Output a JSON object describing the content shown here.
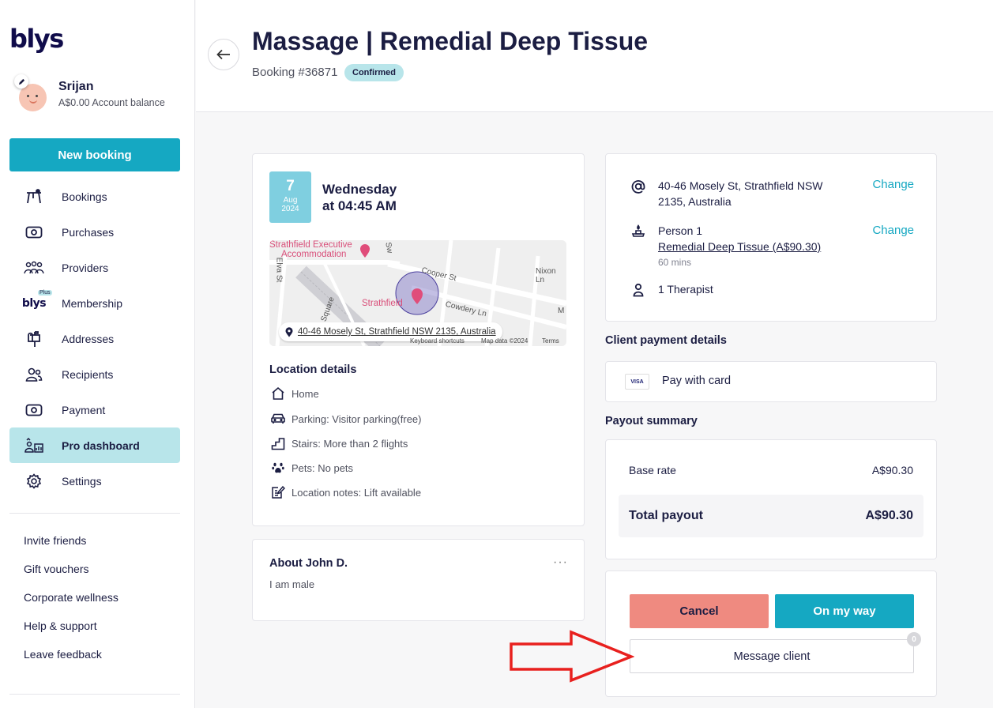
{
  "brand": {
    "logo_text": "blys",
    "accent": "#15a8c2",
    "cancel_color": "#ef8a80",
    "badge_color": "#b8e5ea"
  },
  "profile": {
    "name": "Srijan",
    "balance": "A$0.00 Account balance"
  },
  "sidebar": {
    "new_booking_label": "New booking",
    "items": [
      {
        "label": "Bookings",
        "icon": "bookings-icon"
      },
      {
        "label": "Purchases",
        "icon": "purchases-icon"
      },
      {
        "label": "Providers",
        "icon": "providers-icon"
      },
      {
        "label": "Membership",
        "icon": "blys-plus-icon",
        "icon_text": "blys",
        "icon_badge": "Plus"
      },
      {
        "label": "Addresses",
        "icon": "mailbox-icon"
      },
      {
        "label": "Recipients",
        "icon": "recipients-icon"
      },
      {
        "label": "Payment",
        "icon": "payment-icon"
      },
      {
        "label": "Pro dashboard",
        "icon": "pro-dashboard-icon",
        "active": true
      },
      {
        "label": "Settings",
        "icon": "gear-icon"
      }
    ],
    "links": [
      "Invite friends",
      "Gift vouchers",
      "Corporate wellness",
      "Help & support",
      "Leave feedback"
    ]
  },
  "header": {
    "title": "Massage | Remedial Deep Tissue",
    "booking_number": "Booking #36871",
    "status": "Confirmed"
  },
  "booking": {
    "date_day": "7",
    "date_month": "Aug",
    "date_year": "2024",
    "weekday": "Wednesday",
    "time": "at 04:45 AM",
    "map": {
      "address_label": "40-46 Mosely St, Strathfield NSW 2135, Australia",
      "labels": [
        "Strathfield Executive",
        "Accommodation",
        "Strathfield",
        "Cooper St",
        "Cowdery Ln",
        "Nixon Ln",
        "Elva St",
        "Square",
        "Sw",
        "M"
      ],
      "footer": [
        "Keyboard shortcuts",
        "Map data ©2024",
        "Terms"
      ]
    }
  },
  "location": {
    "title": "Location details",
    "rows": [
      {
        "icon": "home-icon",
        "text": "Home"
      },
      {
        "icon": "car-icon",
        "text": "Parking: Visitor parking(free)"
      },
      {
        "icon": "stairs-icon",
        "text": "Stairs: More than 2 flights"
      },
      {
        "icon": "paw-icon",
        "text": "Pets: No pets"
      },
      {
        "icon": "notes-icon",
        "text": "Location notes: Lift available"
      }
    ]
  },
  "about": {
    "title": "About John D.",
    "text": "I am male",
    "more": "···"
  },
  "service": {
    "address_line1": "40-46 Mosely St, Strathfield NSW",
    "address_line2": "2135, Australia",
    "change_label": "Change",
    "person": "Person 1",
    "treatment": "Remedial Deep Tissue (A$90.30)",
    "duration": "60 mins",
    "therapists": "1 Therapist"
  },
  "payment": {
    "title": "Client payment details",
    "card_brand": "VISA",
    "method": "Pay with card"
  },
  "payout": {
    "title": "Payout summary",
    "base_label": "Base rate",
    "base_value": "A$90.30",
    "total_label": "Total payout",
    "total_value": "A$90.30"
  },
  "actions": {
    "cancel": "Cancel",
    "on_my_way": "On my way",
    "message": "Message client",
    "message_count": "0"
  }
}
